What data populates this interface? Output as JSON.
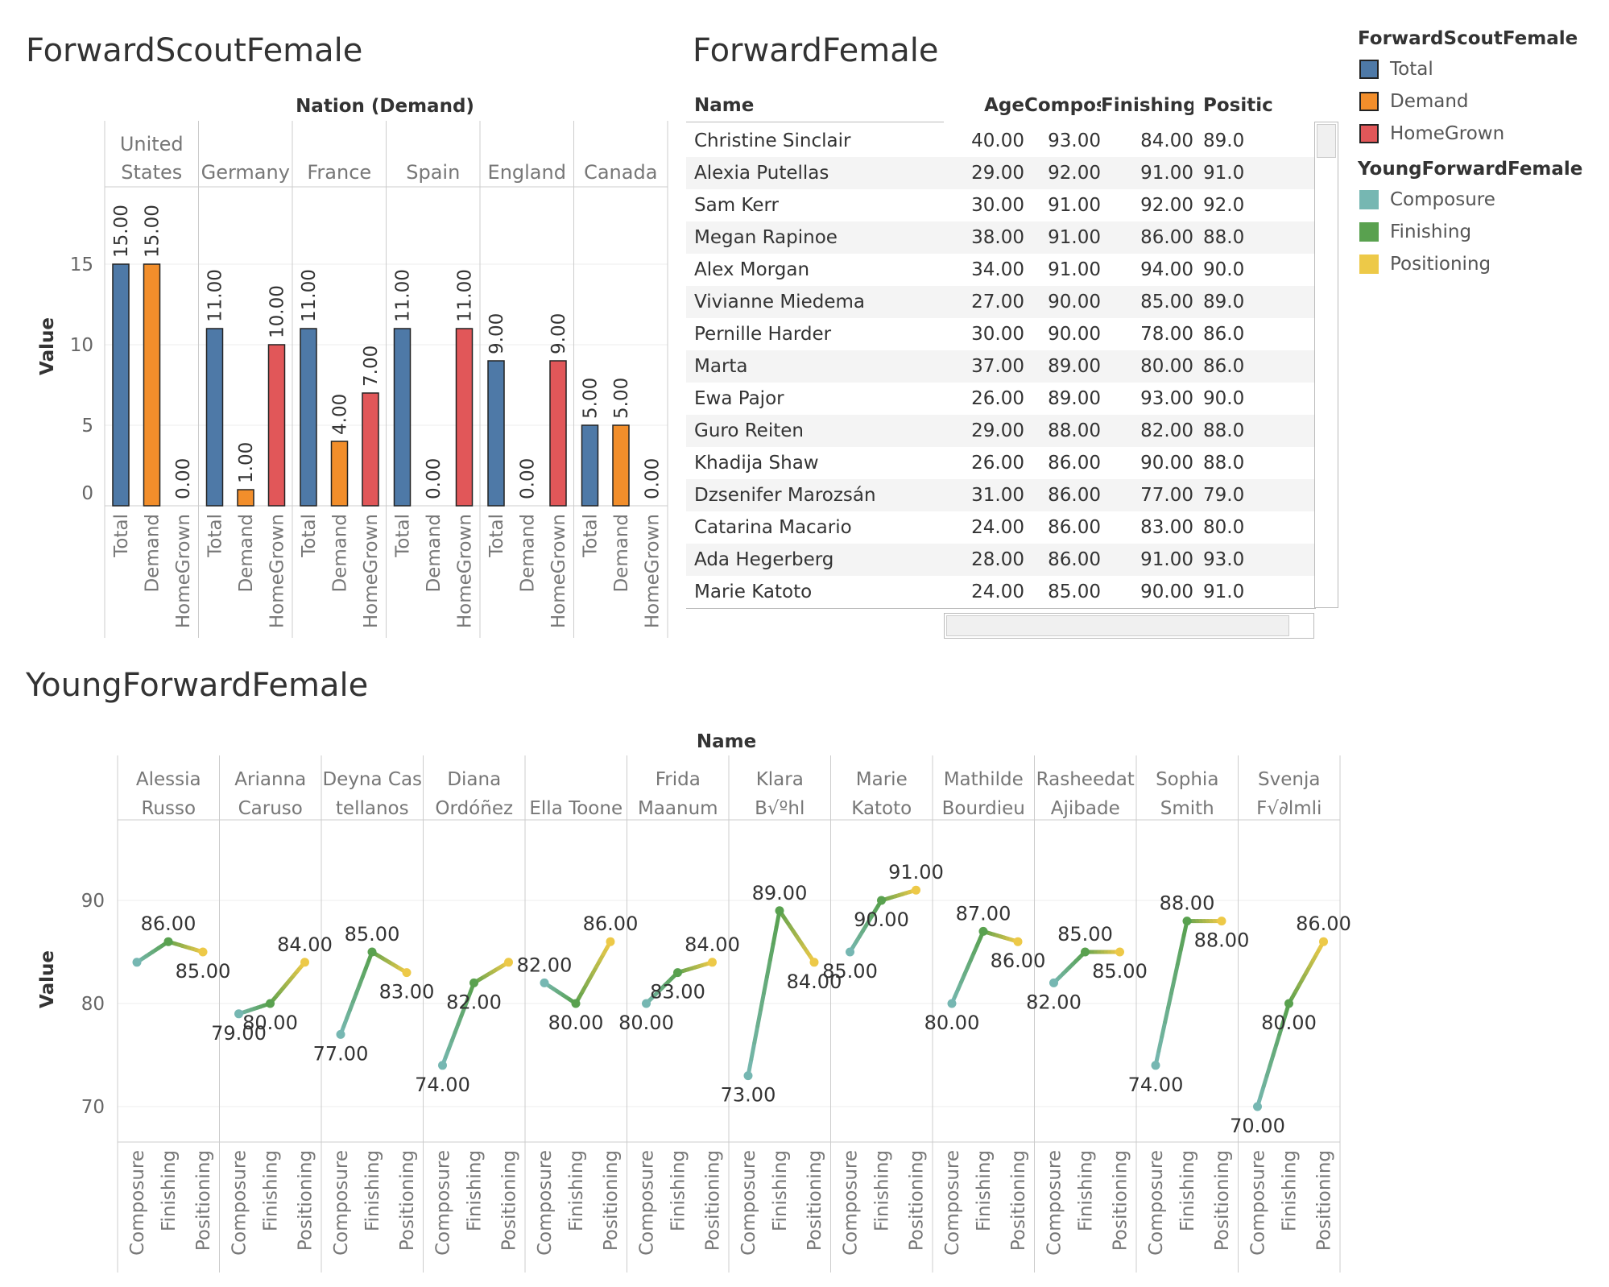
{
  "colors": {
    "total": "#4e79a7",
    "demand": "#f28e2b",
    "homegrown": "#e15759",
    "composure": "#76b7b2",
    "finishing": "#59a14f",
    "positioning": "#edc948"
  },
  "titles": {
    "scout": "ForwardScoutFemale",
    "forward": "ForwardFemale",
    "young": "YoungForwardFemale"
  },
  "chart_data": [
    {
      "type": "bar",
      "title": "ForwardScoutFemale",
      "column_header": "Nation (Demand)",
      "ylabel": "Value",
      "ylim": [
        0,
        15
      ],
      "yticks": [
        "0",
        "5",
        "10",
        "15"
      ],
      "categories": [
        "Total",
        "Demand",
        "HomeGrown"
      ],
      "nations": [
        {
          "name": [
            "United",
            "States"
          ],
          "values": [
            15,
            15,
            0
          ],
          "labels": [
            "15.00",
            "15.00",
            "0.00"
          ]
        },
        {
          "name": [
            "Germany"
          ],
          "values": [
            11,
            1,
            10
          ],
          "labels": [
            "11.00",
            "1.00",
            "10.00"
          ]
        },
        {
          "name": [
            "France"
          ],
          "values": [
            11,
            4,
            7
          ],
          "labels": [
            "11.00",
            "4.00",
            "7.00"
          ]
        },
        {
          "name": [
            "Spain"
          ],
          "values": [
            11,
            0,
            11
          ],
          "labels": [
            "11.00",
            "0.00",
            "11.00"
          ]
        },
        {
          "name": [
            "England"
          ],
          "values": [
            9,
            0,
            9
          ],
          "labels": [
            "9.00",
            "0.00",
            "9.00"
          ]
        },
        {
          "name": [
            "Canada"
          ],
          "values": [
            5,
            5,
            0
          ],
          "labels": [
            "5.00",
            "5.00",
            "0.00"
          ]
        }
      ]
    },
    {
      "type": "table",
      "title": "ForwardFemale",
      "columns": [
        "Name",
        "Age",
        "Compos..",
        "Finishing",
        "Positic"
      ],
      "rows": [
        [
          "Christine Sinclair",
          "40.00",
          "93.00",
          "84.00",
          "89.0"
        ],
        [
          "Alexia Putellas",
          "29.00",
          "92.00",
          "91.00",
          "91.0"
        ],
        [
          "Sam Kerr",
          "30.00",
          "91.00",
          "92.00",
          "92.0"
        ],
        [
          "Megan Rapinoe",
          "38.00",
          "91.00",
          "86.00",
          "88.0"
        ],
        [
          "Alex Morgan",
          "34.00",
          "91.00",
          "94.00",
          "90.0"
        ],
        [
          "Vivianne Miedema",
          "27.00",
          "90.00",
          "85.00",
          "89.0"
        ],
        [
          "Pernille Harder",
          "30.00",
          "90.00",
          "78.00",
          "86.0"
        ],
        [
          "Marta",
          "37.00",
          "89.00",
          "80.00",
          "86.0"
        ],
        [
          "Ewa Pajor",
          "26.00",
          "89.00",
          "93.00",
          "90.0"
        ],
        [
          "Guro Reiten",
          "29.00",
          "88.00",
          "82.00",
          "88.0"
        ],
        [
          "Khadija Shaw",
          "26.00",
          "86.00",
          "90.00",
          "88.0"
        ],
        [
          "Dzsenifer Marozsán",
          "31.00",
          "86.00",
          "77.00",
          "79.0"
        ],
        [
          "Catarina Macario",
          "24.00",
          "86.00",
          "83.00",
          "80.0"
        ],
        [
          "Ada Hegerberg",
          "28.00",
          "86.00",
          "91.00",
          "93.0"
        ],
        [
          "Marie Katoto",
          "24.00",
          "85.00",
          "90.00",
          "91.0"
        ]
      ]
    },
    {
      "type": "line",
      "title": "YoungForwardFemale",
      "column_header": "Name",
      "ylabel": "Value",
      "ylim": [
        65,
        95
      ],
      "yticks": [
        "70",
        "80",
        "90"
      ],
      "categories": [
        "Composure",
        "Finishing",
        "Positioning"
      ],
      "players": [
        {
          "name": [
            "Alessia",
            "Russo"
          ],
          "values": [
            84,
            86,
            85
          ],
          "labels": [
            "",
            "86.00",
            "85.00"
          ]
        },
        {
          "name": [
            "Arianna",
            "Caruso"
          ],
          "values": [
            79,
            80,
            84
          ],
          "labels": [
            "79.00",
            "80.00",
            "84.00"
          ]
        },
        {
          "name": [
            "Deyna Cas",
            "tellanos"
          ],
          "values": [
            77,
            85,
            83
          ],
          "labels": [
            "77.00",
            "85.00",
            "83.00"
          ]
        },
        {
          "name": [
            "Diana",
            "Ordóñez"
          ],
          "values": [
            74,
            82,
            84
          ],
          "labels": [
            "74.00",
            "82.00",
            ""
          ]
        },
        {
          "name": [
            "Ella Toone"
          ],
          "values": [
            82,
            80,
            86
          ],
          "labels": [
            "82.00",
            "80.00",
            "86.00"
          ]
        },
        {
          "name": [
            "Frida",
            "Maanum"
          ],
          "values": [
            80,
            83,
            84
          ],
          "labels": [
            "80.00",
            "83.00",
            "84.00"
          ]
        },
        {
          "name": [
            "Klara",
            "B√ºhl"
          ],
          "values": [
            73,
            89,
            84
          ],
          "labels": [
            "73.00",
            "89.00",
            "84.00"
          ]
        },
        {
          "name": [
            "Marie",
            "Katoto"
          ],
          "values": [
            85,
            90,
            91
          ],
          "labels": [
            "85.00",
            "90.00",
            "91.00"
          ]
        },
        {
          "name": [
            "Mathilde",
            "Bourdieu"
          ],
          "values": [
            80,
            87,
            86
          ],
          "labels": [
            "80.00",
            "87.00",
            "86.00"
          ]
        },
        {
          "name": [
            "Rasheedat",
            "Ajibade"
          ],
          "values": [
            82,
            85,
            85
          ],
          "labels": [
            "82.00",
            "85.00",
            "85.00"
          ]
        },
        {
          "name": [
            "Sophia",
            "Smith"
          ],
          "values": [
            74,
            88,
            88
          ],
          "labels": [
            "74.00",
            "88.00",
            "88.00"
          ]
        },
        {
          "name": [
            "Svenja",
            "F√∂lmli"
          ],
          "values": [
            70,
            80,
            86
          ],
          "labels": [
            "70.00",
            "80.00",
            "86.00"
          ]
        }
      ]
    }
  ],
  "legend": {
    "groups": [
      {
        "title": "ForwardScoutFemale",
        "items": [
          {
            "label": "Total",
            "color": "#4e79a7",
            "outline": true
          },
          {
            "label": "Demand",
            "color": "#f28e2b",
            "outline": true
          },
          {
            "label": "HomeGrown",
            "color": "#e15759",
            "outline": true
          }
        ]
      },
      {
        "title": "YoungForwardFemale",
        "items": [
          {
            "label": "Composure",
            "color": "#76b7b2",
            "outline": false
          },
          {
            "label": "Finishing",
            "color": "#59a14f",
            "outline": false
          },
          {
            "label": "Positioning",
            "color": "#edc948",
            "outline": false
          }
        ]
      }
    ]
  }
}
